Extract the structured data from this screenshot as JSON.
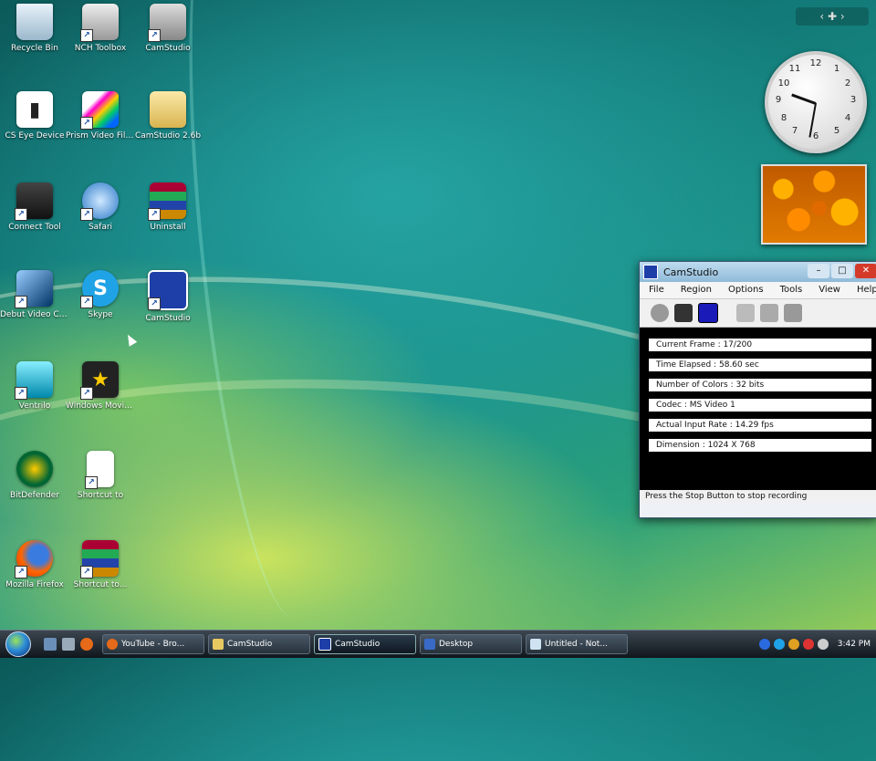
{
  "desktop": {
    "icons": [
      {
        "label": "Recycle Bin"
      },
      {
        "label": "NCH Toolbox"
      },
      {
        "label": "CamStudio"
      },
      {
        "label": "CS Eye Device"
      },
      {
        "label": "Prism Video File Converter"
      },
      {
        "label": "CamStudio 2.6b"
      },
      {
        "label": "Connect Tool"
      },
      {
        "label": "Safari"
      },
      {
        "label": "Uninstall"
      },
      {
        "label": "Debut Video Capture"
      },
      {
        "label": "Skype"
      },
      {
        "label": "CamStudio"
      },
      {
        "label": "Ventrilo"
      },
      {
        "label": "Windows Movie Maker"
      },
      {
        "label": "BitDefender"
      },
      {
        "label": "Shortcut to"
      },
      {
        "label": "Mozilla Firefox"
      },
      {
        "label": "Shortcut to..."
      }
    ]
  },
  "gadgets": {
    "clock": {
      "numbers": [
        "12",
        "1",
        "2",
        "3",
        "4",
        "5",
        "6",
        "7",
        "8",
        "9",
        "10",
        "11"
      ]
    }
  },
  "camstudio": {
    "title": "CamStudio",
    "menu": [
      "File",
      "Region",
      "Options",
      "Tools",
      "View",
      "Help"
    ],
    "stats": [
      "Current Frame : 17/200",
      "Time Elapsed : 58.60 sec",
      "Number of Colors : 32 bits",
      "Codec : MS Video 1",
      "Actual Input Rate : 14.29 fps",
      "Dimension : 1024 X 768"
    ],
    "status": "Press the Stop Button to stop recording"
  },
  "taskbar": {
    "tasks": [
      {
        "label": "YouTube - Bro..."
      },
      {
        "label": "CamStudio"
      },
      {
        "label": "CamStudio"
      },
      {
        "label": "Desktop"
      },
      {
        "label": "Untitled - Not..."
      }
    ],
    "time": "3:42 PM"
  }
}
